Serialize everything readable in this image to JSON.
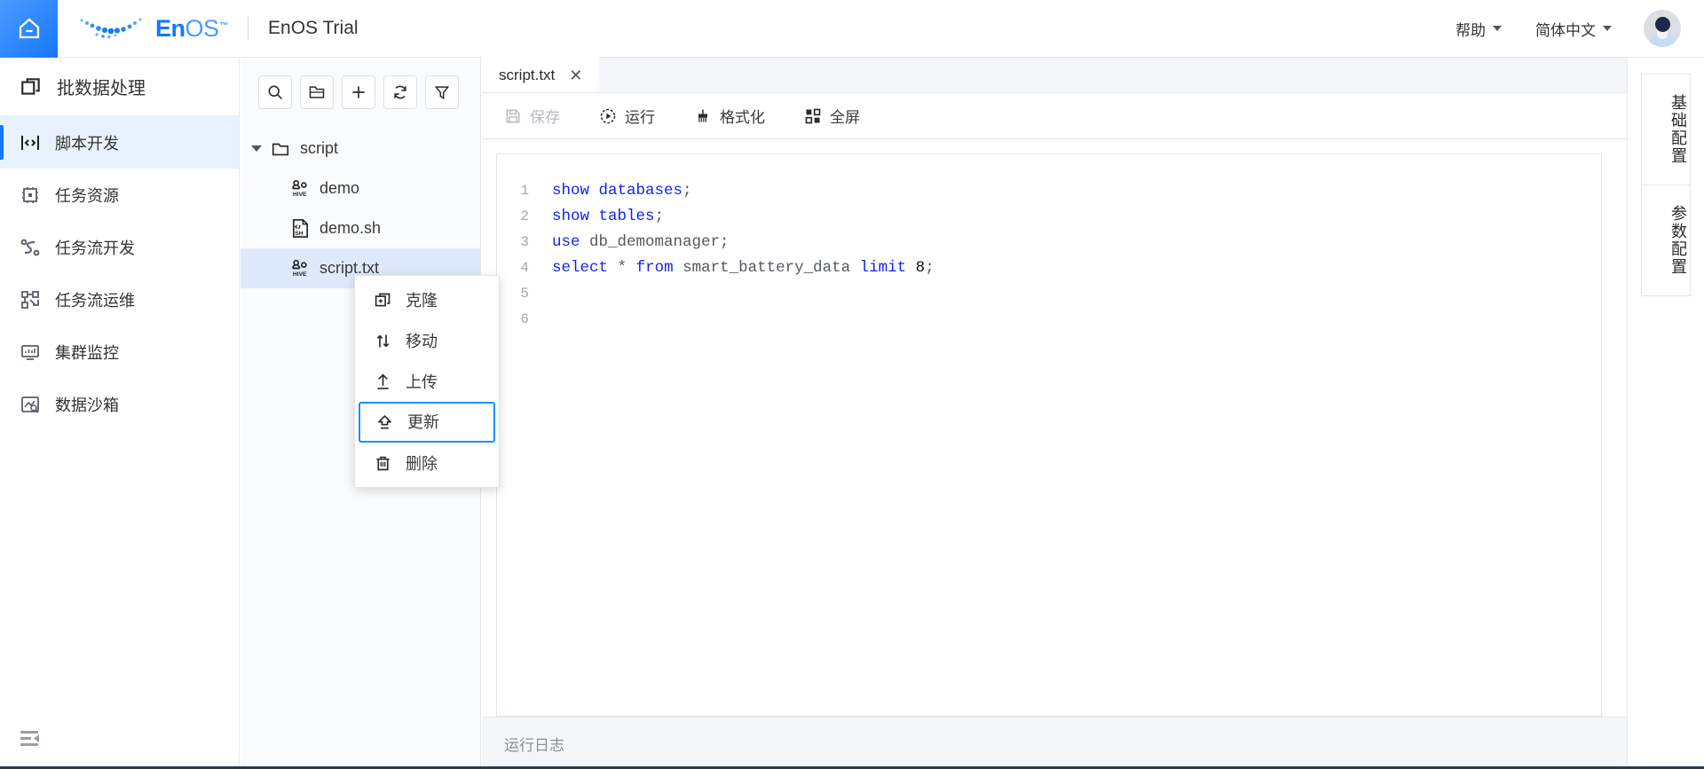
{
  "header": {
    "home_icon": "home-icon",
    "brand_en": "En",
    "brand_os": "OS",
    "brand_tm": "™",
    "product_title": "EnOS Trial",
    "help_label": "帮助",
    "language_label": "简体中文",
    "avatar_icon": "user-avatar-icon"
  },
  "sidebar": {
    "title": "批数据处理",
    "items": [
      {
        "label": "脚本开发",
        "icon": "script-dev-icon",
        "active": true
      },
      {
        "label": "任务资源",
        "icon": "task-resource-icon",
        "active": false
      },
      {
        "label": "任务流开发",
        "icon": "workflow-dev-icon",
        "active": false
      },
      {
        "label": "任务流运维",
        "icon": "workflow-ops-icon",
        "active": false
      },
      {
        "label": "集群监控",
        "icon": "cluster-monitor-icon",
        "active": false
      },
      {
        "label": "数据沙箱",
        "icon": "data-sandbox-icon",
        "active": false
      }
    ],
    "collapse_icon": "collapse-sidebar-icon"
  },
  "file_tree": {
    "toolbar": [
      {
        "name": "search-icon"
      },
      {
        "name": "new-folder-icon"
      },
      {
        "name": "add-icon"
      },
      {
        "name": "refresh-icon"
      },
      {
        "name": "filter-icon"
      }
    ],
    "root": {
      "label": "script",
      "icon": "folder-icon",
      "expanded": true
    },
    "children": [
      {
        "label": "demo",
        "icon": "hive-file-icon",
        "selected": false
      },
      {
        "label": "demo.sh",
        "icon": "sh-file-icon",
        "selected": false
      },
      {
        "label": "script.txt",
        "icon": "hive-file-icon",
        "selected": true
      }
    ]
  },
  "context_menu": {
    "items": [
      {
        "label": "克隆",
        "icon": "clone-icon",
        "focused": false
      },
      {
        "label": "移动",
        "icon": "move-icon",
        "focused": false
      },
      {
        "label": "上传",
        "icon": "upload-icon",
        "focused": false
      },
      {
        "label": "更新",
        "icon": "update-icon",
        "focused": true
      },
      {
        "label": "删除",
        "icon": "delete-icon",
        "focused": false
      }
    ]
  },
  "editor": {
    "tab_label": "script.txt",
    "tab_close": "✕",
    "toolbar": [
      {
        "label": "保存",
        "icon": "save-icon",
        "disabled": true
      },
      {
        "label": "运行",
        "icon": "run-icon",
        "disabled": false
      },
      {
        "label": "格式化",
        "icon": "format-icon",
        "disabled": false
      },
      {
        "label": "全屏",
        "icon": "fullscreen-icon",
        "disabled": false
      }
    ],
    "lines": [
      {
        "no": "1",
        "tokens": [
          {
            "t": "show",
            "c": "kw"
          },
          {
            "t": " ",
            "c": "op"
          },
          {
            "t": "databases",
            "c": "kw"
          },
          {
            "t": ";",
            "c": "op"
          }
        ]
      },
      {
        "no": "2",
        "tokens": [
          {
            "t": "show",
            "c": "kw"
          },
          {
            "t": " ",
            "c": "op"
          },
          {
            "t": "tables",
            "c": "kw"
          },
          {
            "t": ";",
            "c": "op"
          }
        ]
      },
      {
        "no": "3",
        "tokens": [
          {
            "t": "use",
            "c": "kw"
          },
          {
            "t": " ",
            "c": "op"
          },
          {
            "t": "db_demomanager;",
            "c": "id"
          }
        ]
      },
      {
        "no": "4",
        "tokens": [
          {
            "t": "select",
            "c": "kw"
          },
          {
            "t": " ",
            "c": "op"
          },
          {
            "t": "*",
            "c": "op"
          },
          {
            "t": " ",
            "c": "op"
          },
          {
            "t": "from",
            "c": "kw"
          },
          {
            "t": " ",
            "c": "op"
          },
          {
            "t": "smart_battery_data",
            "c": "id"
          },
          {
            "t": " ",
            "c": "op"
          },
          {
            "t": "limit",
            "c": "kw"
          },
          {
            "t": " ",
            "c": "op"
          },
          {
            "t": "8",
            "c": "num"
          },
          {
            "t": ";",
            "c": "op"
          }
        ]
      },
      {
        "no": "5",
        "tokens": []
      },
      {
        "no": "6",
        "tokens": []
      }
    ],
    "log_placeholder": "运行日志"
  },
  "right_rail": {
    "tabs": [
      {
        "label": "基础配置"
      },
      {
        "label": "参数配置"
      }
    ]
  },
  "colors": {
    "accent": "#1677ff",
    "focus_ring": "#1890ff",
    "selected_row": "#dee9fb",
    "active_nav": "#e8f1fe",
    "keyword": "#1423ee",
    "identifier": "#555a60",
    "muted_text": "#8a8f99"
  }
}
